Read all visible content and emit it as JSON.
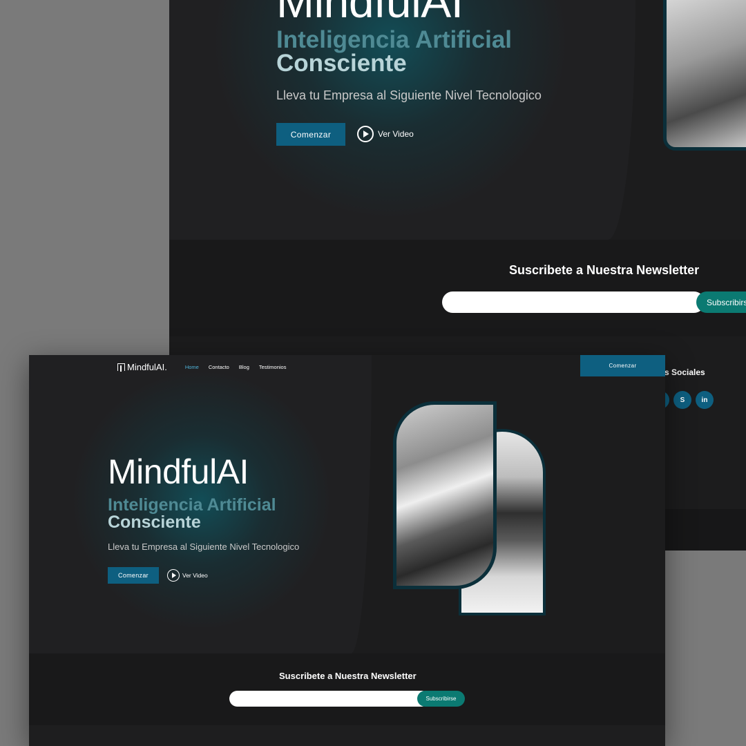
{
  "brand": {
    "name": "MindfulAI."
  },
  "nav": {
    "links": [
      "Home",
      "Contacto",
      "Blog",
      "Testimonios"
    ],
    "cta": "Comenzar"
  },
  "hero": {
    "title": "MindfulAI",
    "subtitle_line1": "Inteligencia Artificial",
    "subtitle_line2": "Consciente",
    "tagline": "Lleva tu Empresa al Siguiente Nivel Tecnologico",
    "primary_button": "Comenzar",
    "video_link": "Ver Video"
  },
  "newsletter": {
    "title": "Suscribete a Nuestra Newsletter",
    "input_placeholder": "",
    "button": "Subscribirse",
    "button_back_crop": "Subscribirs"
  },
  "footer": {
    "social_title_crop": "s Sociales",
    "social_icons": [
      "skype-icon",
      "linkedin-icon"
    ]
  },
  "colors": {
    "accent_blue": "#0e5f80",
    "accent_teal": "#0b7a72",
    "subtitle_teal": "#4f8a94",
    "background": "#1c1c1d"
  }
}
